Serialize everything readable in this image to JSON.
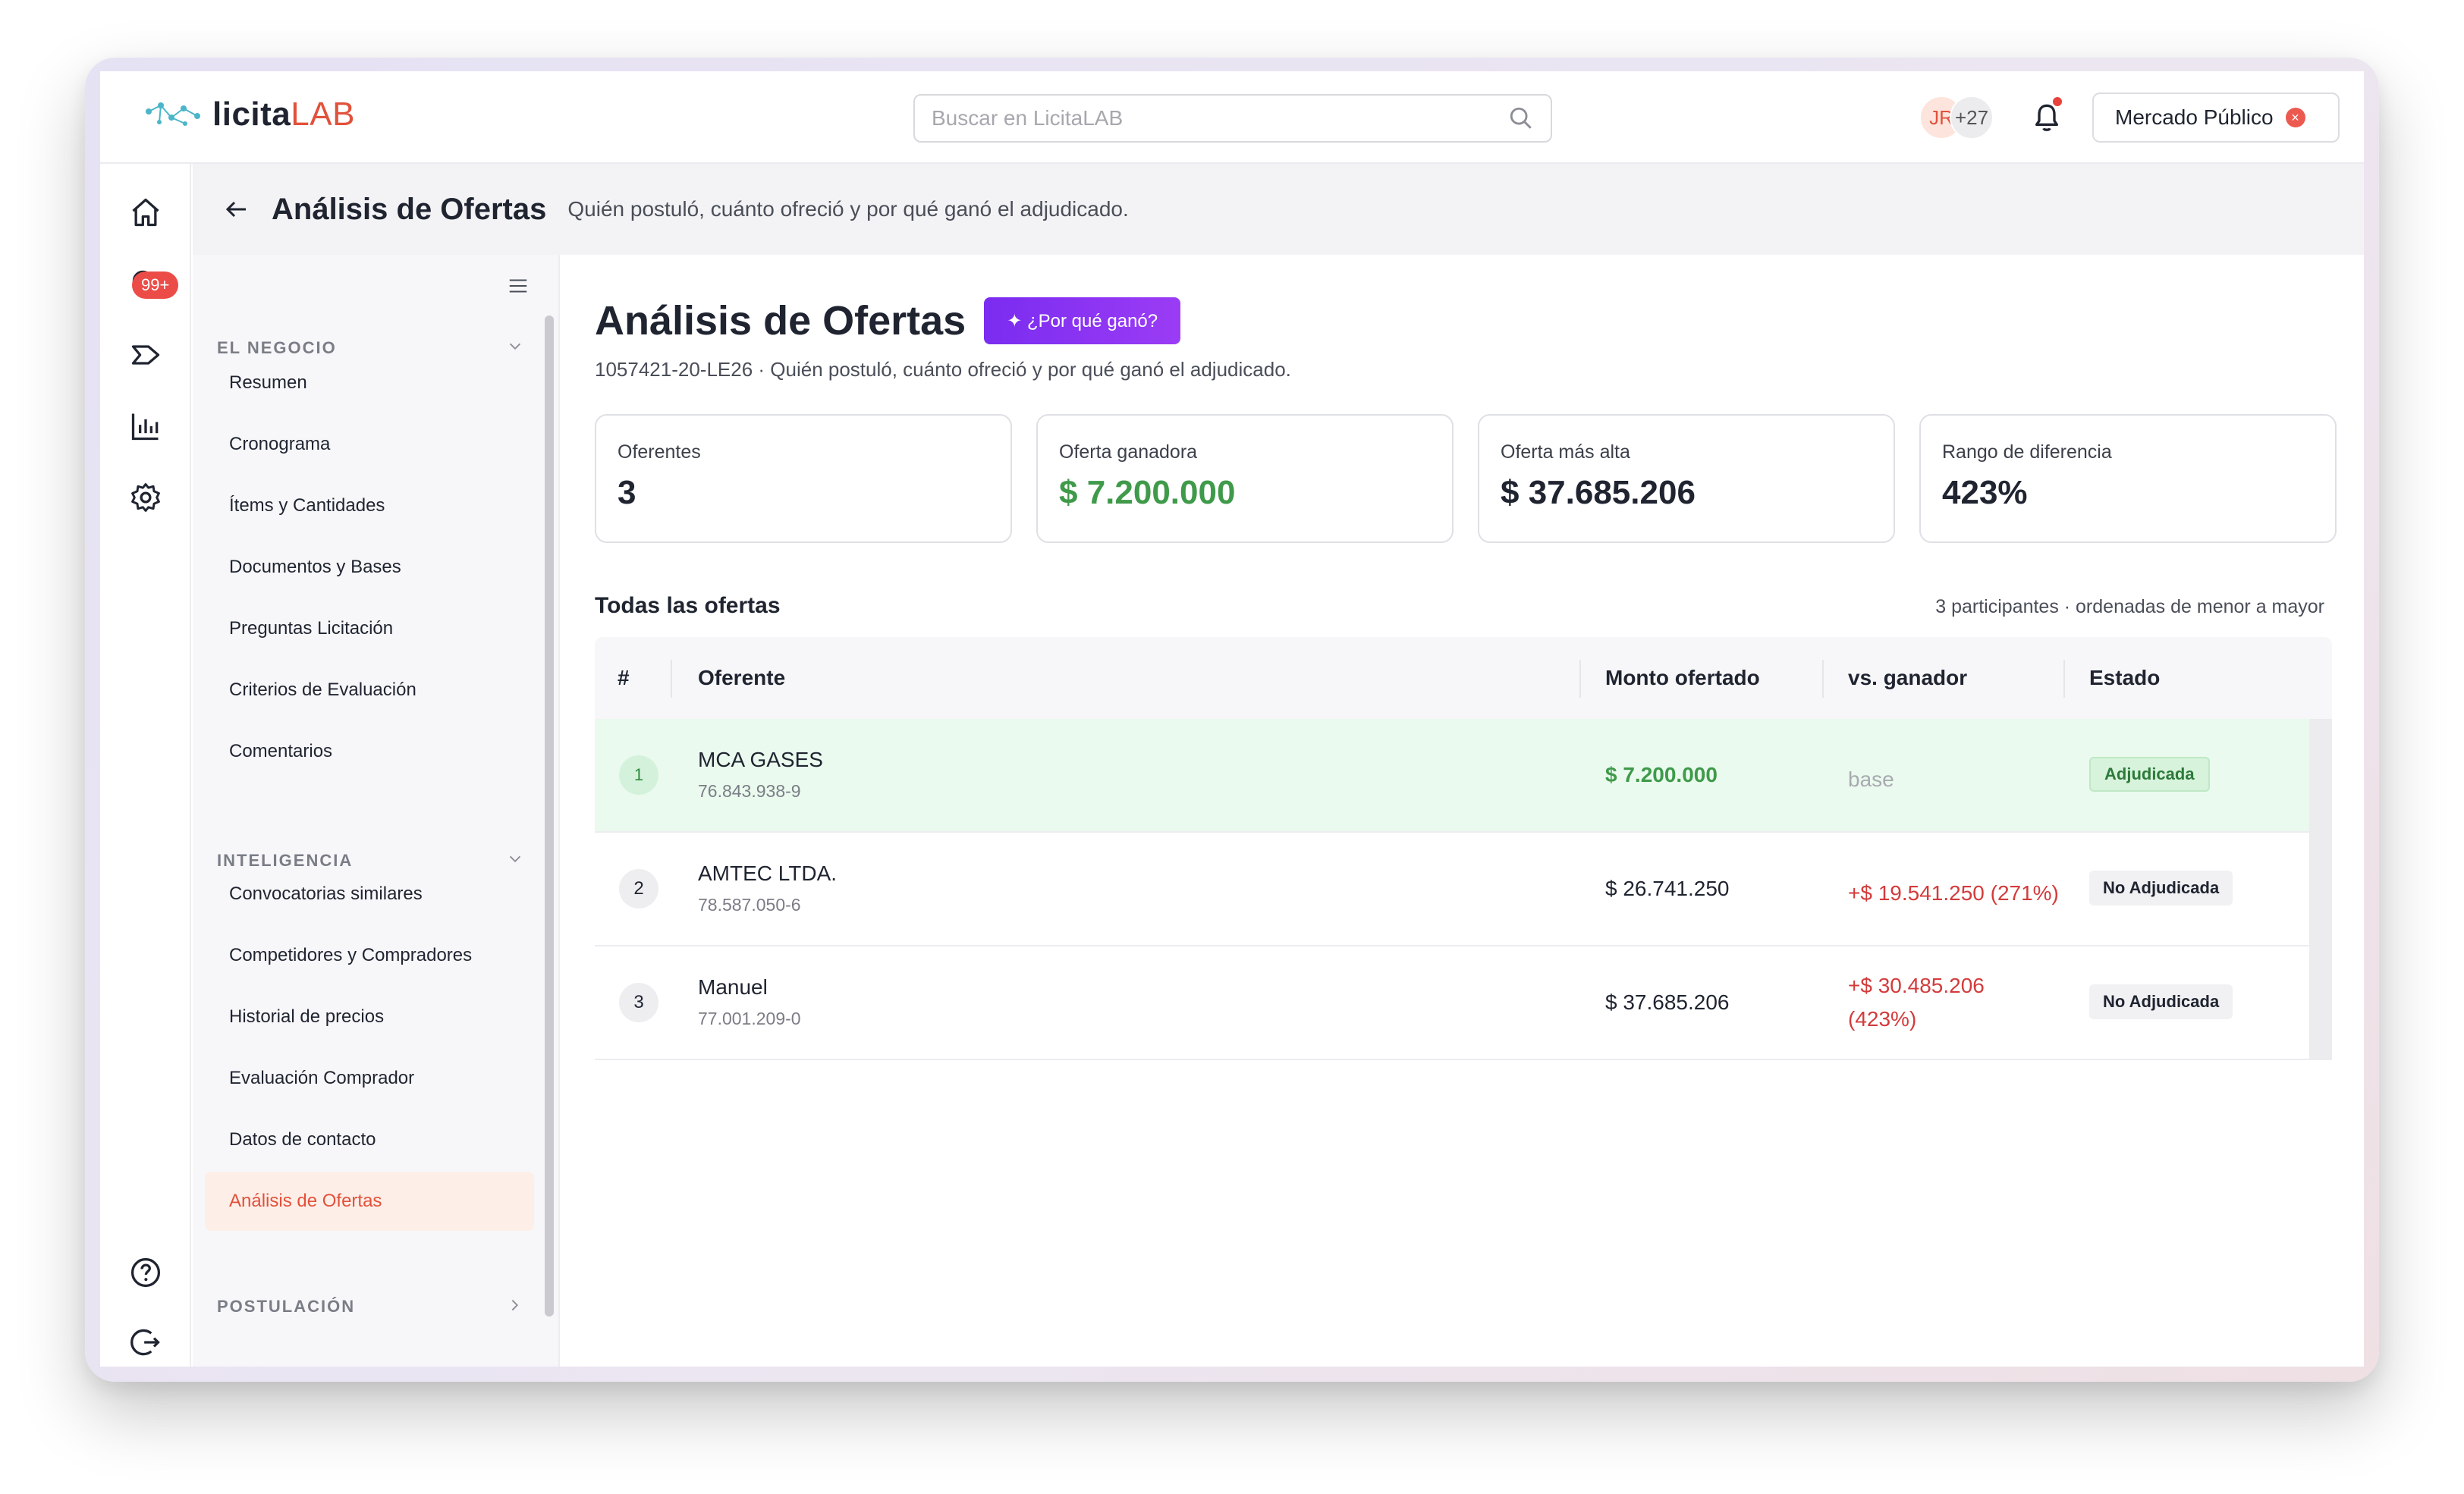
{
  "app": {
    "logo_bold": "licita",
    "logo_accent": "LAB",
    "accent_color": "#e2513a",
    "search_placeholder": "Buscar en LicitaLAB",
    "avatar_initials": "JR",
    "avatar_more": "+27",
    "market_label": "Mercado Público"
  },
  "rail": {
    "icons": [
      "home-icon",
      "search-icon",
      "send-icon",
      "bar-chart-icon",
      "gear-icon",
      "help-icon",
      "logout-icon"
    ],
    "badge": "99+"
  },
  "pagehead": {
    "title": "Análisis de Ofertas",
    "subtitle": "Quién postuló, cuánto ofreció y por qué ganó el adjudicado."
  },
  "sidenav": {
    "section1": "EL NEGOCIO",
    "section1_items": [
      "Resumen",
      "Cronograma",
      "Ítems y Cantidades",
      "Documentos y Bases",
      "Preguntas Licitación",
      "Criterios de Evaluación",
      "Comentarios"
    ],
    "section2": "INTELIGENCIA",
    "section2_items": [
      "Convocatorias similares",
      "Competidores y Compradores",
      "Historial de precios",
      "Evaluación Comprador",
      "Datos de contacto",
      "Análisis de Ofertas"
    ],
    "active_item": "Análisis de Ofertas",
    "section3": "POSTULACIÓN"
  },
  "main": {
    "title": "Análisis de Ofertas",
    "why_button": "✦ ¿Por qué ganó?",
    "subline": "1057421-20-LE26 · Quién postuló, cuánto ofreció y por qué ganó el adjudicado.",
    "cards": [
      {
        "label": "Oferentes",
        "value": "3"
      },
      {
        "label": "Oferta ganadora",
        "value": "$ 7.200.000"
      },
      {
        "label": "Oferta más alta",
        "value": "$ 37.685.206"
      },
      {
        "label": "Rango de diferencia",
        "value": "423%"
      }
    ],
    "section_title": "Todas las ofertas",
    "section_meta": "3 participantes · ordenadas de menor a mayor",
    "table": {
      "headers": [
        "#",
        "Oferente",
        "Monto ofertado",
        "vs. ganador",
        "Estado"
      ],
      "rows": [
        {
          "rank": "1",
          "name": "MCA GASES",
          "rut": "76.843.938-9",
          "amount": "$ 7.200.000",
          "diff": "base",
          "status": "Adjudicada"
        },
        {
          "rank": "2",
          "name": "AMTEC LTDA.",
          "rut": "78.587.050-6",
          "amount": "$ 26.741.250",
          "diff": "+$ 19.541.250 (271%)",
          "status": "No Adjudicada"
        },
        {
          "rank": "3",
          "name": "Manuel",
          "rut": "77.001.209-0",
          "amount": "$ 37.685.206",
          "diff": "+$ 30.485.206 (423%)",
          "status": "No Adjudicada"
        }
      ]
    }
  },
  "fabs": [
    "sparkle-icon",
    "chat-icon"
  ]
}
